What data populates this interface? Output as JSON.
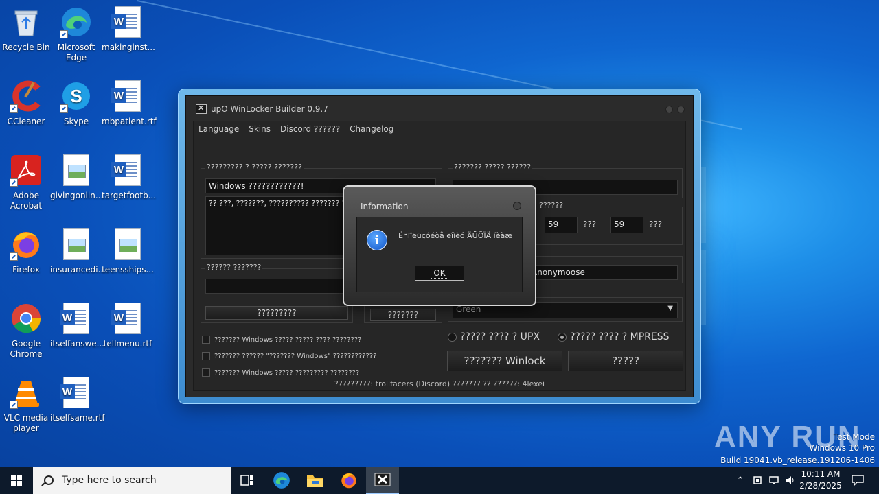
{
  "desktop": {
    "icons": [
      {
        "label": "Recycle Bin",
        "icon": "recycle-bin-icon"
      },
      {
        "label": "Microsoft Edge",
        "icon": "edge-icon"
      },
      {
        "label": "makinginst...",
        "icon": "word-doc-icon"
      },
      {
        "label": "CCleaner",
        "icon": "ccleaner-icon"
      },
      {
        "label": "Skype",
        "icon": "skype-icon"
      },
      {
        "label": "mbpatient.rtf",
        "icon": "word-doc-icon"
      },
      {
        "label": "Adobe Acrobat",
        "icon": "acrobat-icon"
      },
      {
        "label": "givingonlin...",
        "icon": "image-file-icon"
      },
      {
        "label": "targetfootb...",
        "icon": "word-doc-icon"
      },
      {
        "label": "Firefox",
        "icon": "firefox-icon"
      },
      {
        "label": "insurancedi...",
        "icon": "image-file-icon"
      },
      {
        "label": "teensships...",
        "icon": "image-file-icon"
      },
      {
        "label": "Google Chrome",
        "icon": "chrome-icon"
      },
      {
        "label": "itselfanswe...",
        "icon": "word-doc-icon"
      },
      {
        "label": "tellmenu.rtf",
        "icon": "word-doc-icon"
      },
      {
        "label": "VLC media player",
        "icon": "vlc-icon"
      },
      {
        "label": "itselfsame.rtf",
        "icon": "word-doc-icon"
      }
    ]
  },
  "app": {
    "title": "upO WinLocker Builder 0.9.7",
    "menu": [
      "Language",
      "Skins",
      "Discord ??????",
      "Changelog"
    ],
    "group1_label": "????????? ? ????? ???????",
    "title_field": "Windows ????????????!",
    "message_text": "?? ???, ???????, ?????????? ??????? ?? ?????? ?????",
    "group2_label": "?????? ???????",
    "group2_button": "?????????",
    "icon_button": "???????",
    "group_right1_label": "??????? ????? ??????",
    "group_right2_label": "??????",
    "timer_minutes": "59",
    "timer_seconds": "59",
    "timer_unit_a": "???",
    "timer_unit_b": "???",
    "author_label": "?",
    "author_value": "Anonymoose",
    "skin_select": "Green",
    "checkbox1": "??????? Windows ????? ????? ???? ????????",
    "checkbox2": "??????? ?????? \"??????? Windows\" ????????????",
    "checkbox3": "??????? Windows ????? ????????? ????????",
    "radio_upx": "????? ???? ? UPX",
    "radio_mpress": "????? ???? ? MPRESS",
    "build_button": "??????? Winlock",
    "exit_button": "?????",
    "status": "?????????: trollfacers (Discord) ??????? ?? ??????: 4lexei"
  },
  "dialog": {
    "title": "Information",
    "message": "Ëñïîëüçóéòå ëîìèó ÄÜÕÏÄ íèàæ",
    "ok": "OK"
  },
  "watermark": {
    "brand": "ANY RUN",
    "line1": "Test Mode",
    "line2": "Windows 10 Pro",
    "line3": "Build 19041.vb_release.191206-1406"
  },
  "taskbar": {
    "search_placeholder": "Type here to search",
    "time": "10:11 AM",
    "date": "2/28/2025"
  }
}
